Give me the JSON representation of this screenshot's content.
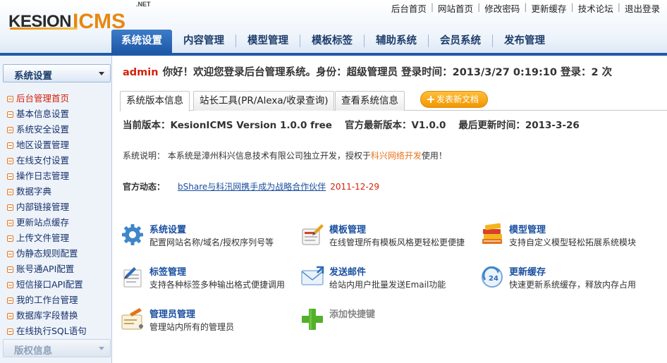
{
  "brand": {
    "kesion": "KESION",
    "icms": "ICMS",
    "net": ".NET"
  },
  "toplinks": [
    "后台首页",
    "网站首页",
    "修改密码",
    "更新缓存",
    "技术论坛",
    "退出登录"
  ],
  "nav": [
    "系统设置",
    "内容管理",
    "模型管理",
    "模板标签",
    "辅助系统",
    "会员系统",
    "发布管理"
  ],
  "sidebar": {
    "header": "系统设置",
    "items": [
      "后台管理首页",
      "基本信息设置",
      "系统安全设置",
      "地区设置管理",
      "在线支付设置",
      "操作日志管理",
      "数据字典",
      "内部链接管理",
      "更新站点缓存",
      "上传文件管理",
      "伪静态规则配置",
      "账号通API配置",
      "短信接口API配置",
      "我的工作台管理",
      "数据库字段替换",
      "在线执行SQL语句"
    ],
    "footer": "版权信息"
  },
  "welcome": {
    "user": "admin",
    "text": "你好！欢迎您登录后台管理系统。身份：超级管理员 登录时间：2013/3/27 0:19:10 登录：2 次"
  },
  "tabs": [
    "系统版本信息",
    "站长工具(PR/Alexa/收录查询)",
    "查看系统信息"
  ],
  "add_button": "发表新文档",
  "version": {
    "current": "当前版本：KesionICMS Version 1.0.0 free",
    "latest": "官方最新版本：V1.0.0",
    "updated": "最后更新时间：2013-3-26"
  },
  "description": {
    "prefix": "系统说明：  本系统是漳州科兴信息技术有限公司独立开发，授权于",
    "highlight": "科兴网络开发",
    "suffix": "使用！"
  },
  "news": {
    "label": "官方动态：",
    "item": "bShare与科汛网携手成为战略合作伙伴",
    "date": "2011-12-29"
  },
  "quick": [
    {
      "title": "系统设置",
      "desc": "配置网站名称/域名/授权序列号等",
      "icon": "gear-icon"
    },
    {
      "title": "模板管理",
      "desc": "在线管理所有模板风格更轻松更便捷",
      "icon": "template-icon"
    },
    {
      "title": "模型管理",
      "desc": "支持自定义模型轻松拓展系统模块",
      "icon": "books-icon"
    },
    {
      "title": "标签管理",
      "desc": "支持各种标签多种输出格式便捷调用",
      "icon": "tag-edit-icon"
    },
    {
      "title": "发送邮件",
      "desc": "给站内用户批量发送Email功能",
      "icon": "mail-icon"
    },
    {
      "title": "更新缓存",
      "desc": "快速更新系统缓存，释放内存占用",
      "icon": "refresh-24-icon"
    },
    {
      "title": "管理员管理",
      "desc": "管理站内所有的管理员",
      "icon": "admin-card-icon"
    },
    {
      "title": "添加快捷键",
      "desc": "",
      "icon": "add-shortcut-icon"
    }
  ],
  "colors": {
    "nav_active": "#2c6cbc",
    "accent_orange": "#f29600",
    "link_blue": "#1a4fa0",
    "alert_red": "#d4220c"
  }
}
